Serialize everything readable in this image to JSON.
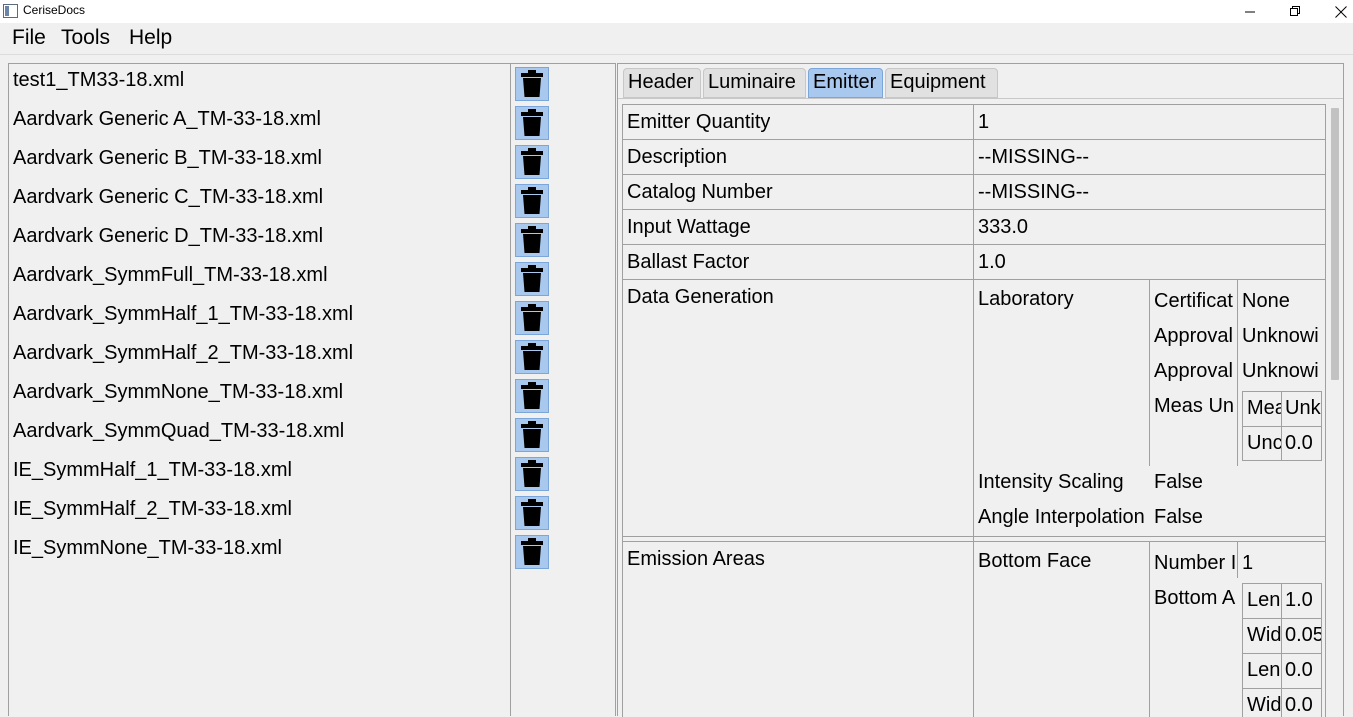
{
  "window": {
    "title": "CeriseDocs"
  },
  "menu": {
    "file": "File",
    "tools": "Tools",
    "help": "Help"
  },
  "files": [
    "test1_TM33-18.xml",
    "Aardvark Generic A_TM-33-18.xml",
    "Aardvark Generic B_TM-33-18.xml",
    "Aardvark Generic C_TM-33-18.xml",
    "Aardvark Generic D_TM-33-18.xml",
    "Aardvark_SymmFull_TM-33-18.xml",
    "Aardvark_SymmHalf_1_TM-33-18.xml",
    "Aardvark_SymmHalf_2_TM-33-18.xml",
    "Aardvark_SymmNone_TM-33-18.xml",
    "Aardvark_SymmQuad_TM-33-18.xml",
    "IE_SymmHalf_1_TM-33-18.xml",
    "IE_SymmHalf_2_TM-33-18.xml",
    "IE_SymmNone_TM-33-18.xml"
  ],
  "icons": {
    "delete": "trash-icon"
  },
  "tabs": {
    "header": "Header",
    "luminaire": "Luminaire",
    "emitter": "Emitter",
    "equipment": "Equipment",
    "active": "Emitter"
  },
  "emitter": {
    "quantity_label": "Emitter Quantity",
    "quantity_value": "1",
    "description_label": "Description",
    "description_value": "--MISSING--",
    "catalog_label": "Catalog Number",
    "catalog_value": "--MISSING--",
    "wattage_label": "Input Wattage",
    "wattage_value": "333.0",
    "ballast_label": "Ballast Factor",
    "ballast_value": "1.0",
    "datagen": {
      "label": "Data Generation",
      "laboratory_label": "Laboratory",
      "certificate_label": "Certificat",
      "certificate_value": "None",
      "approval1_label": "Approval",
      "approval1_value": "Unknowi",
      "approval2_label": "Approval",
      "approval2_value": "Unknowi",
      "meas_label": "Meas Un",
      "meas_row1_label": "Mea",
      "meas_row1_value": "Unk",
      "meas_row2_label": "Unc",
      "meas_row2_value": "0.0",
      "intensity_label": "Intensity Scaling",
      "intensity_value": "False",
      "angle_label": "Angle Interpolation",
      "angle_value": "False"
    },
    "emission": {
      "label": "Emission Areas",
      "bottom_face_label": "Bottom Face",
      "number_label": "Number I",
      "number_value": "1",
      "bottom_area_label": "Bottom A",
      "rows": [
        {
          "label": "Len",
          "value": "1.0"
        },
        {
          "label": "Wid",
          "value": "0.05"
        },
        {
          "label": "Len",
          "value": "0.0"
        },
        {
          "label": "Wid",
          "value": "0.0"
        }
      ]
    }
  },
  "colors": {
    "accent": "#a8c8ee",
    "border": "#a0a0a0",
    "background": "#f0f0f0"
  }
}
